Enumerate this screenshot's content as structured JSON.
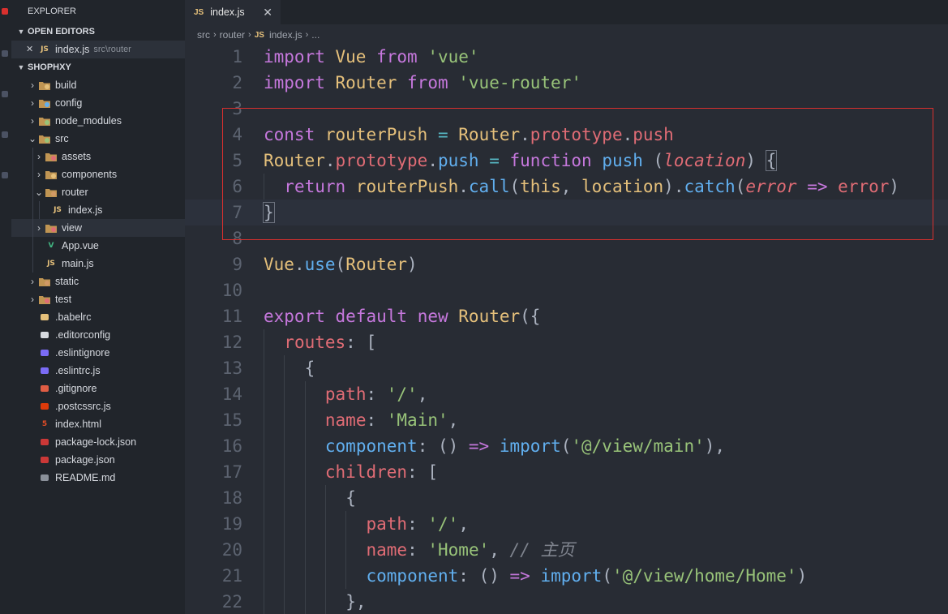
{
  "colors": {
    "editor_bg": "#282c34",
    "sidebar_bg": "#21252b",
    "keyword": "#c678dd",
    "string": "#98c379",
    "class": "#e5c07b",
    "property": "#e06c75",
    "function": "#61afef",
    "highlight_box": "#d9302e"
  },
  "explorer": {
    "title": "EXPLORER",
    "open_editors": {
      "label": "OPEN EDITORS",
      "items": [
        {
          "close": "✕",
          "icon": "JS",
          "name": "index.js",
          "path": "src\\router"
        }
      ]
    },
    "project": {
      "label": "SHOPHXY",
      "tree": [
        {
          "name": "build",
          "type": "folder",
          "icon": "folder-build-icon"
        },
        {
          "name": "config",
          "type": "folder",
          "icon": "folder-config-icon"
        },
        {
          "name": "node_modules",
          "type": "folder",
          "icon": "folder-node-icon"
        },
        {
          "name": "src",
          "type": "folder-open",
          "icon": "folder-src-icon"
        },
        {
          "name": "assets",
          "type": "folder",
          "icon": "folder-assets-icon"
        },
        {
          "name": "components",
          "type": "folder",
          "icon": "folder-components-icon"
        },
        {
          "name": "router",
          "type": "folder-open",
          "icon": "folder-router-icon"
        },
        {
          "name": "index.js",
          "type": "file",
          "icon": "js-icon",
          "glyph": "JS"
        },
        {
          "name": "view",
          "type": "folder",
          "icon": "folder-view-icon"
        },
        {
          "name": "App.vue",
          "type": "file",
          "icon": "vue-icon",
          "glyph": "V"
        },
        {
          "name": "main.js",
          "type": "file",
          "icon": "js-icon",
          "glyph": "JS"
        },
        {
          "name": "static",
          "type": "folder",
          "icon": "folder-static-icon"
        },
        {
          "name": "test",
          "type": "folder",
          "icon": "folder-test-icon"
        },
        {
          "name": ".babelrc",
          "type": "file",
          "icon": "babel-icon"
        },
        {
          "name": ".editorconfig",
          "type": "file",
          "icon": "editorconfig-icon"
        },
        {
          "name": ".eslintignore",
          "type": "file",
          "icon": "eslint-icon"
        },
        {
          "name": ".eslintrc.js",
          "type": "file",
          "icon": "eslint-icon"
        },
        {
          "name": ".gitignore",
          "type": "file",
          "icon": "git-icon"
        },
        {
          "name": ".postcssrc.js",
          "type": "file",
          "icon": "postcss-icon"
        },
        {
          "name": "index.html",
          "type": "file",
          "icon": "html-icon",
          "glyph": "5"
        },
        {
          "name": "package-lock.json",
          "type": "file",
          "icon": "npm-icon"
        },
        {
          "name": "package.json",
          "type": "file",
          "icon": "npm-icon"
        },
        {
          "name": "README.md",
          "type": "file",
          "icon": "markdown-icon"
        }
      ]
    }
  },
  "tab": {
    "icon": "JS",
    "label": "index.js",
    "close": "✕"
  },
  "breadcrumb": [
    "src",
    "router",
    "index.js",
    "..."
  ],
  "breadcrumb_sep": "›",
  "breadcrumb_icon": "JS",
  "editor": {
    "current_line": 7,
    "lines": [
      {
        "n": "1",
        "indent": 0,
        "tokens": [
          [
            "kw",
            "import"
          ],
          [
            "pl",
            " "
          ],
          [
            "var",
            "Vue"
          ],
          [
            "pl",
            " "
          ],
          [
            "kw",
            "from"
          ],
          [
            "pl",
            " "
          ],
          [
            "str",
            "'vue'"
          ]
        ]
      },
      {
        "n": "2",
        "indent": 0,
        "tokens": [
          [
            "kw",
            "import"
          ],
          [
            "pl",
            " "
          ],
          [
            "var",
            "Router"
          ],
          [
            "pl",
            " "
          ],
          [
            "kw",
            "from"
          ],
          [
            "pl",
            " "
          ],
          [
            "str",
            "'vue-router'"
          ]
        ]
      },
      {
        "n": "3",
        "indent": 0,
        "tokens": []
      },
      {
        "n": "4",
        "indent": 0,
        "tokens": [
          [
            "kw",
            "const"
          ],
          [
            "pl",
            " "
          ],
          [
            "var",
            "routerPush"
          ],
          [
            "pl",
            " "
          ],
          [
            "op",
            "="
          ],
          [
            "pl",
            " "
          ],
          [
            "var",
            "Router"
          ],
          [
            "pl",
            "."
          ],
          [
            "prop",
            "prototype"
          ],
          [
            "pl",
            "."
          ],
          [
            "prop",
            "push"
          ]
        ]
      },
      {
        "n": "5",
        "indent": 0,
        "tokens": [
          [
            "var",
            "Router"
          ],
          [
            "pl",
            "."
          ],
          [
            "prop",
            "prototype"
          ],
          [
            "pl",
            "."
          ],
          [
            "fn",
            "push"
          ],
          [
            "pl",
            " "
          ],
          [
            "op",
            "="
          ],
          [
            "pl",
            " "
          ],
          [
            "kw",
            "function"
          ],
          [
            "pl",
            " "
          ],
          [
            "fn",
            "push"
          ],
          [
            "pl",
            " ("
          ],
          [
            "param",
            "location"
          ],
          [
            "pl",
            ") "
          ],
          [
            "brk",
            "{"
          ]
        ]
      },
      {
        "n": "6",
        "indent": 1,
        "tokens": [
          [
            "kw",
            "return"
          ],
          [
            "pl",
            " "
          ],
          [
            "var",
            "routerPush"
          ],
          [
            "pl",
            "."
          ],
          [
            "fn",
            "call"
          ],
          [
            "pl",
            "("
          ],
          [
            "var",
            "this"
          ],
          [
            "pl",
            ", "
          ],
          [
            "var",
            "location"
          ],
          [
            "pl",
            ")."
          ],
          [
            "fn",
            "catch"
          ],
          [
            "pl",
            "("
          ],
          [
            "param",
            "error"
          ],
          [
            "pl",
            " "
          ],
          [
            "kw",
            "=>"
          ],
          [
            "pl",
            " "
          ],
          [
            "prop",
            "error"
          ],
          [
            "pl",
            ")"
          ]
        ]
      },
      {
        "n": "7",
        "indent": 0,
        "tokens": [
          [
            "brk",
            "}"
          ]
        ]
      },
      {
        "n": "8",
        "indent": 0,
        "tokens": []
      },
      {
        "n": "9",
        "indent": 0,
        "tokens": [
          [
            "var",
            "Vue"
          ],
          [
            "pl",
            "."
          ],
          [
            "fn",
            "use"
          ],
          [
            "pl",
            "("
          ],
          [
            "var",
            "Router"
          ],
          [
            "pl",
            ")"
          ]
        ]
      },
      {
        "n": "10",
        "indent": 0,
        "tokens": []
      },
      {
        "n": "11",
        "indent": 0,
        "tokens": [
          [
            "kw",
            "export"
          ],
          [
            "pl",
            " "
          ],
          [
            "kw",
            "default"
          ],
          [
            "pl",
            " "
          ],
          [
            "kw",
            "new"
          ],
          [
            "pl",
            " "
          ],
          [
            "var",
            "Router"
          ],
          [
            "pl",
            "({"
          ]
        ]
      },
      {
        "n": "12",
        "indent": 1,
        "tokens": [
          [
            "prop",
            "routes"
          ],
          [
            "pl",
            ": ["
          ]
        ]
      },
      {
        "n": "13",
        "indent": 2,
        "tokens": [
          [
            "pl",
            "{"
          ]
        ]
      },
      {
        "n": "14",
        "indent": 3,
        "tokens": [
          [
            "prop",
            "path"
          ],
          [
            "pl",
            ": "
          ],
          [
            "str",
            "'/'"
          ],
          [
            "pl",
            ","
          ]
        ]
      },
      {
        "n": "15",
        "indent": 3,
        "tokens": [
          [
            "prop",
            "name"
          ],
          [
            "pl",
            ": "
          ],
          [
            "str",
            "'Main'"
          ],
          [
            "pl",
            ","
          ]
        ]
      },
      {
        "n": "16",
        "indent": 3,
        "tokens": [
          [
            "fn",
            "component"
          ],
          [
            "pl",
            ": () "
          ],
          [
            "kw",
            "=>"
          ],
          [
            "pl",
            " "
          ],
          [
            "fn",
            "import"
          ],
          [
            "pl",
            "("
          ],
          [
            "str",
            "'@/view/main'"
          ],
          [
            "pl",
            "),"
          ]
        ]
      },
      {
        "n": "17",
        "indent": 3,
        "tokens": [
          [
            "prop",
            "children"
          ],
          [
            "pl",
            ": ["
          ]
        ]
      },
      {
        "n": "18",
        "indent": 4,
        "tokens": [
          [
            "pl",
            "{"
          ]
        ]
      },
      {
        "n": "19",
        "indent": 5,
        "tokens": [
          [
            "prop",
            "path"
          ],
          [
            "pl",
            ": "
          ],
          [
            "str",
            "'/'"
          ],
          [
            "pl",
            ","
          ]
        ]
      },
      {
        "n": "20",
        "indent": 5,
        "tokens": [
          [
            "prop",
            "name"
          ],
          [
            "pl",
            ": "
          ],
          [
            "str",
            "'Home'"
          ],
          [
            "pl",
            ", "
          ],
          [
            "cmt",
            "// 主页"
          ]
        ]
      },
      {
        "n": "21",
        "indent": 5,
        "tokens": [
          [
            "fn",
            "component"
          ],
          [
            "pl",
            ": () "
          ],
          [
            "kw",
            "=>"
          ],
          [
            "pl",
            " "
          ],
          [
            "fn",
            "import"
          ],
          [
            "pl",
            "("
          ],
          [
            "str",
            "'@/view/home/Home'"
          ],
          [
            "pl",
            ")"
          ]
        ]
      },
      {
        "n": "22",
        "indent": 4,
        "tokens": [
          [
            "pl",
            "},"
          ]
        ]
      }
    ]
  }
}
